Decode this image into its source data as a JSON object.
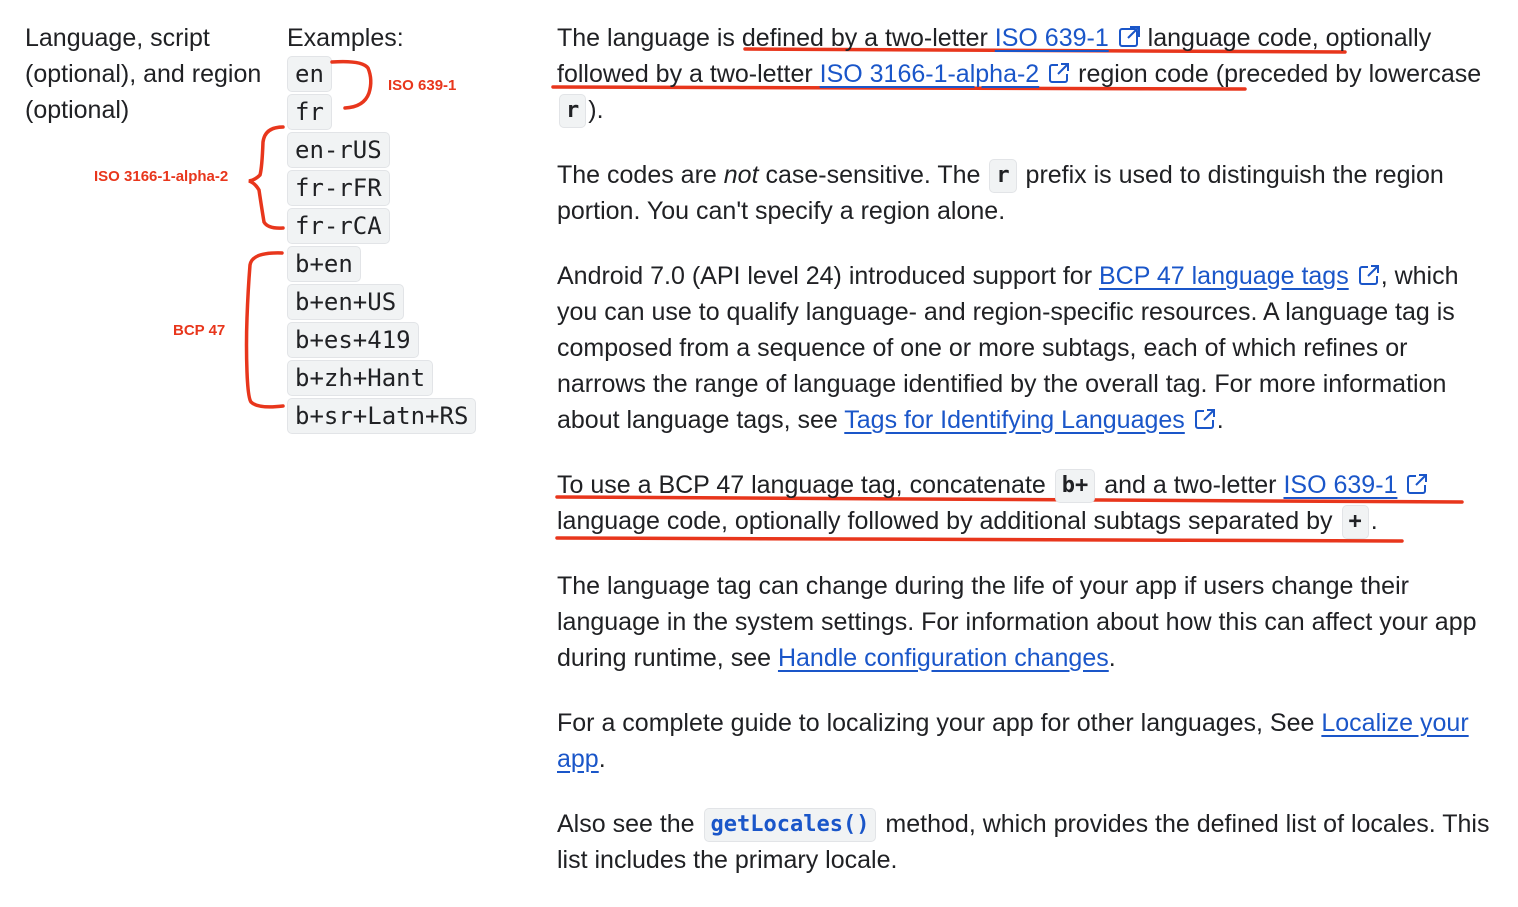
{
  "qualifier_label": "Language, script (optional), and region (optional)",
  "examples_heading": "Examples:",
  "codes": [
    "en",
    "fr",
    "en-rUS",
    "fr-rFR",
    "fr-rCA",
    "b+en",
    "b+en+US",
    "b+es+419",
    "b+zh+Hant",
    "b+sr+Latn+RS"
  ],
  "annotations": {
    "color": "#e8361c",
    "iso639": "ISO 639-1",
    "iso3166": "ISO 3166-1-alpha-2",
    "bcp47": "BCP 47"
  },
  "link_color": "#1a56c9",
  "external_icon": "external-link-icon",
  "p1": {
    "t1": "The language is defined by a two-letter ",
    "link1": "ISO 639-1",
    "t2": " language code, optionally followed by a two-letter ",
    "link2": "ISO 3166-1-alpha-2",
    "t3": " region code (preceded by lowercase ",
    "code": "r",
    "t4": ")."
  },
  "p2": {
    "t1": "The codes are ",
    "em": "not",
    "t2": " case-sensitive. The ",
    "code": "r",
    "t3": " prefix is used to distinguish the region portion. You can't specify a region alone."
  },
  "p3": {
    "t1": "Android 7.0 (API level 24) introduced support for ",
    "link1": "BCP 47 language tags",
    "t2": ", which you can use to qualify language- and region-specific resources. A language tag is composed from a sequence of one or more subtags, each of which refines or narrows the range of language identified by the overall tag. For more information about language tags, see ",
    "link2": "Tags for Identifying Languages",
    "t3": "."
  },
  "p4": {
    "t1": "To use a BCP 47 language tag, concatenate ",
    "code1": "b+",
    "t2": " and a two-letter ",
    "link1": "ISO 639-1",
    "t3": " language code, optionally followed by additional subtags separated by ",
    "code2": "+",
    "t4": "."
  },
  "p5": {
    "t1": "The language tag can change during the life of your app if users change their language in the system settings. For information about how this can affect your app during runtime, see ",
    "link1": "Handle configuration changes",
    "t2": "."
  },
  "p6": {
    "t1": "For a complete guide to localizing your app for other languages, See ",
    "link1": "Localize your app",
    "t2": "."
  },
  "p7": {
    "t1": "Also see the ",
    "code": "getLocales()",
    "t2": " method, which provides the defined list of locales. This list includes the primary locale."
  }
}
